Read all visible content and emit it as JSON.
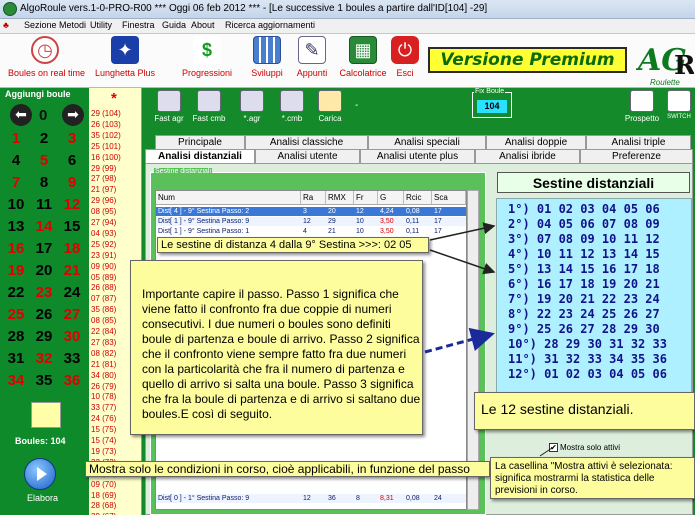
{
  "window": {
    "title": "AlgoRoule vers.1-0-PRO-R00  ***  Oggi 06 feb 2012  ***  - [Le successive 1 boules a partire dall'ID[104] -29]"
  },
  "menu": [
    "Sezione Metodi",
    "Utility",
    "Finestra",
    "Guida",
    "About",
    "Ricerca aggiornamenti"
  ],
  "toolbar": {
    "items": [
      {
        "label": "Boules on real time",
        "icon": "alarm-clock-icon"
      },
      {
        "label": "Lunghetta Plus",
        "icon": "lottery-icon"
      },
      {
        "label": "Progressioni",
        "icon": "dollar-icon"
      },
      {
        "label": "Sviluppi",
        "icon": "calendar-icon"
      },
      {
        "label": "Appunti",
        "icon": "notepad-icon"
      },
      {
        "label": "Calcolatrice",
        "icon": "calculator-icon"
      },
      {
        "label": "Esci",
        "icon": "exit-icon"
      }
    ],
    "versione": "Versione Premium",
    "logo": "AGR Roulette"
  },
  "left": {
    "title": "Aggiungi boule",
    "zero": "0",
    "numbers": [
      "1",
      "2",
      "3",
      "4",
      "5",
      "6",
      "7",
      "8",
      "9",
      "10",
      "11",
      "12",
      "13",
      "14",
      "15",
      "16",
      "17",
      "18",
      "19",
      "20",
      "21",
      "22",
      "23",
      "24",
      "25",
      "26",
      "27",
      "28",
      "29",
      "30",
      "31",
      "32",
      "33",
      "34",
      "35",
      "36"
    ],
    "boules_label": "Boules: 104",
    "elabora": "Elabora"
  },
  "freq": {
    "star": "*",
    "items": [
      "29 (104)",
      "26 (103)",
      "35 (102)",
      "25 (101)",
      "16 (100)",
      "29 (99)",
      "27 (98)",
      "21 (97)",
      "29 (96)",
      "08 (95)",
      "27 (94)",
      "04 (93)",
      "25 (92)",
      "23 (91)",
      "09 (90)",
      "05 (89)",
      "26 (88)",
      "07 (87)",
      "35 (86)",
      "08 (85)",
      "22 (84)",
      "27 (83)",
      "08 (82)",
      "21 (81)",
      "34 (80)",
      "26 (79)",
      "10 (78)",
      "33 (77)",
      "24 (76)",
      "15 (75)",
      "15 (74)",
      "19 (73)",
      "22 (72)",
      "14 (71)",
      "09 (70)",
      "18 (69)",
      "28 (68)",
      "29 (67)"
    ]
  },
  "main_toolbar": {
    "items": [
      {
        "label": "Fast agr",
        "icon": "save-icon"
      },
      {
        "label": "Fast cmb",
        "icon": "save-icon"
      },
      {
        "label": "*.agr",
        "icon": "save-icon"
      },
      {
        "label": "*.cmb",
        "icon": "save-icon"
      },
      {
        "label": "Carica",
        "icon": "folder-icon"
      },
      {
        "label": "Prospetto",
        "icon": "html-icon"
      },
      {
        "label": "SWITCH",
        "icon": "switch-icon"
      }
    ],
    "dash": "-",
    "fix_label": "Fix Boule",
    "fix_value": "104"
  },
  "tabs_row1": [
    "Principale",
    "Analisi classiche",
    "Analisi speciali",
    "Analisi doppie",
    "Analisi triple"
  ],
  "tabs_row2": [
    "Analisi distanziali",
    "Analisi utente",
    "Analisi utente plus",
    "Analisi ibride",
    "Preferenze"
  ],
  "sestine_group": {
    "label": "Sestine distanziali",
    "columns": [
      "Num",
      "Ra",
      "RMX",
      "Fr",
      "G",
      "Rcic",
      "Sca"
    ],
    "rows": [
      [
        "Dist[ 4 ] - 9° Sestina Passo: 2",
        "3",
        "20",
        "12",
        "4,24",
        "0,08",
        "17"
      ],
      [
        "Dist[ 1 ] - 9° Sestina Passo: 9",
        "12",
        "29",
        "10",
        "3,50",
        "0,11",
        "17"
      ],
      [
        "Dist[ 1 ] - 9° Sestina Passo: 1",
        "4",
        "21",
        "10",
        "3,50",
        "0,11",
        "17"
      ],
      [
        "Dist[ 0 ] - 1° Sestina Passo: 9",
        "12",
        "36",
        "8",
        "8,31",
        "0,08",
        "24"
      ]
    ]
  },
  "sestine": {
    "title": "Sestine distanziali",
    "rows": [
      "1°) 01 02 03 04 05 06",
      "2°) 04 05 06 07 08 09",
      "3°) 07 08 09 10 11 12",
      "4°) 10 11 12 13 14 15",
      "5°) 13 14 15 16 17 18",
      "6°) 16 17 18 19 20 21",
      "7°) 19 20 21 22 23 24",
      "8°) 22 23 24 25 26 27",
      "9°) 25 26 27 28 29 30",
      "10°) 28 29 30 31 32 33",
      "11°) 31 32 33 34 35 36",
      "12°) 01 02 03 04 05 06"
    ],
    "mostra_label": "Mostra solo attivi"
  },
  "notes": {
    "top": "Le sestine di distanza 4 dalla 9° Sestina >>>: 02 05",
    "big": "Importante capire il passo. Passo 1 significa che viene fatto il confronto fra due coppie di numeri consecutivi. I due numeri o boules sono definiti boule di partenza e boule di arrivo. Passo 2 significa che il confronto viene sempre fatto fra due numeri con la particolarità che fra il numero di partenza e quello di arrivo si salta una boule. Passo 3 significa che fra la boule di partenza e di arrivo si saltano due boules.E così di seguito.",
    "dodici": "Le 12 sestine distanziali.",
    "mostra": "Mostra solo le condizioni in corso, cioè applicabili, in funzione del passo",
    "casella": "La casellina \"Mostra attivi è selezionata: significa mostrarmi la statistica delle previsioni in corso."
  }
}
